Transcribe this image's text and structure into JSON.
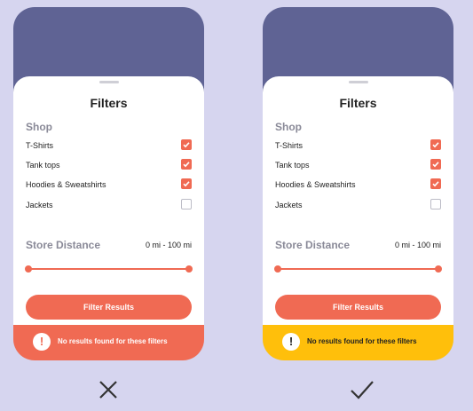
{
  "screens": [
    {
      "variant": "incorrect",
      "title": "Filters",
      "shop_label": "Shop",
      "items": [
        {
          "label": "T-Shirts",
          "checked": true
        },
        {
          "label": "Tank tops",
          "checked": true
        },
        {
          "label": "Hoodies & Sweatshirts",
          "checked": true
        },
        {
          "label": "Jackets",
          "checked": false
        }
      ],
      "distance_label": "Store Distance",
      "distance_value": "0 mi - 100 mi",
      "button_label": "Filter Results",
      "banner_icon": "!",
      "banner_message": "No results found for these filters",
      "banner_color": "#f06a53"
    },
    {
      "variant": "correct",
      "title": "Filters",
      "shop_label": "Shop",
      "items": [
        {
          "label": "T-Shirts",
          "checked": true
        },
        {
          "label": "Tank tops",
          "checked": true
        },
        {
          "label": "Hoodies & Sweatshirts",
          "checked": true
        },
        {
          "label": "Jackets",
          "checked": false
        }
      ],
      "distance_label": "Store Distance",
      "distance_value": "0 mi - 100 mi",
      "button_label": "Filter Results",
      "banner_icon": "!",
      "banner_message": "No results found for these filters",
      "banner_color": "#ffbf0b"
    }
  ],
  "colors": {
    "background": "#d6d5ef",
    "header": "#5f6394",
    "accent": "#f06a53",
    "warning": "#ffbf0b"
  },
  "marks": {
    "left": "cross-icon",
    "right": "checkmark-icon"
  }
}
